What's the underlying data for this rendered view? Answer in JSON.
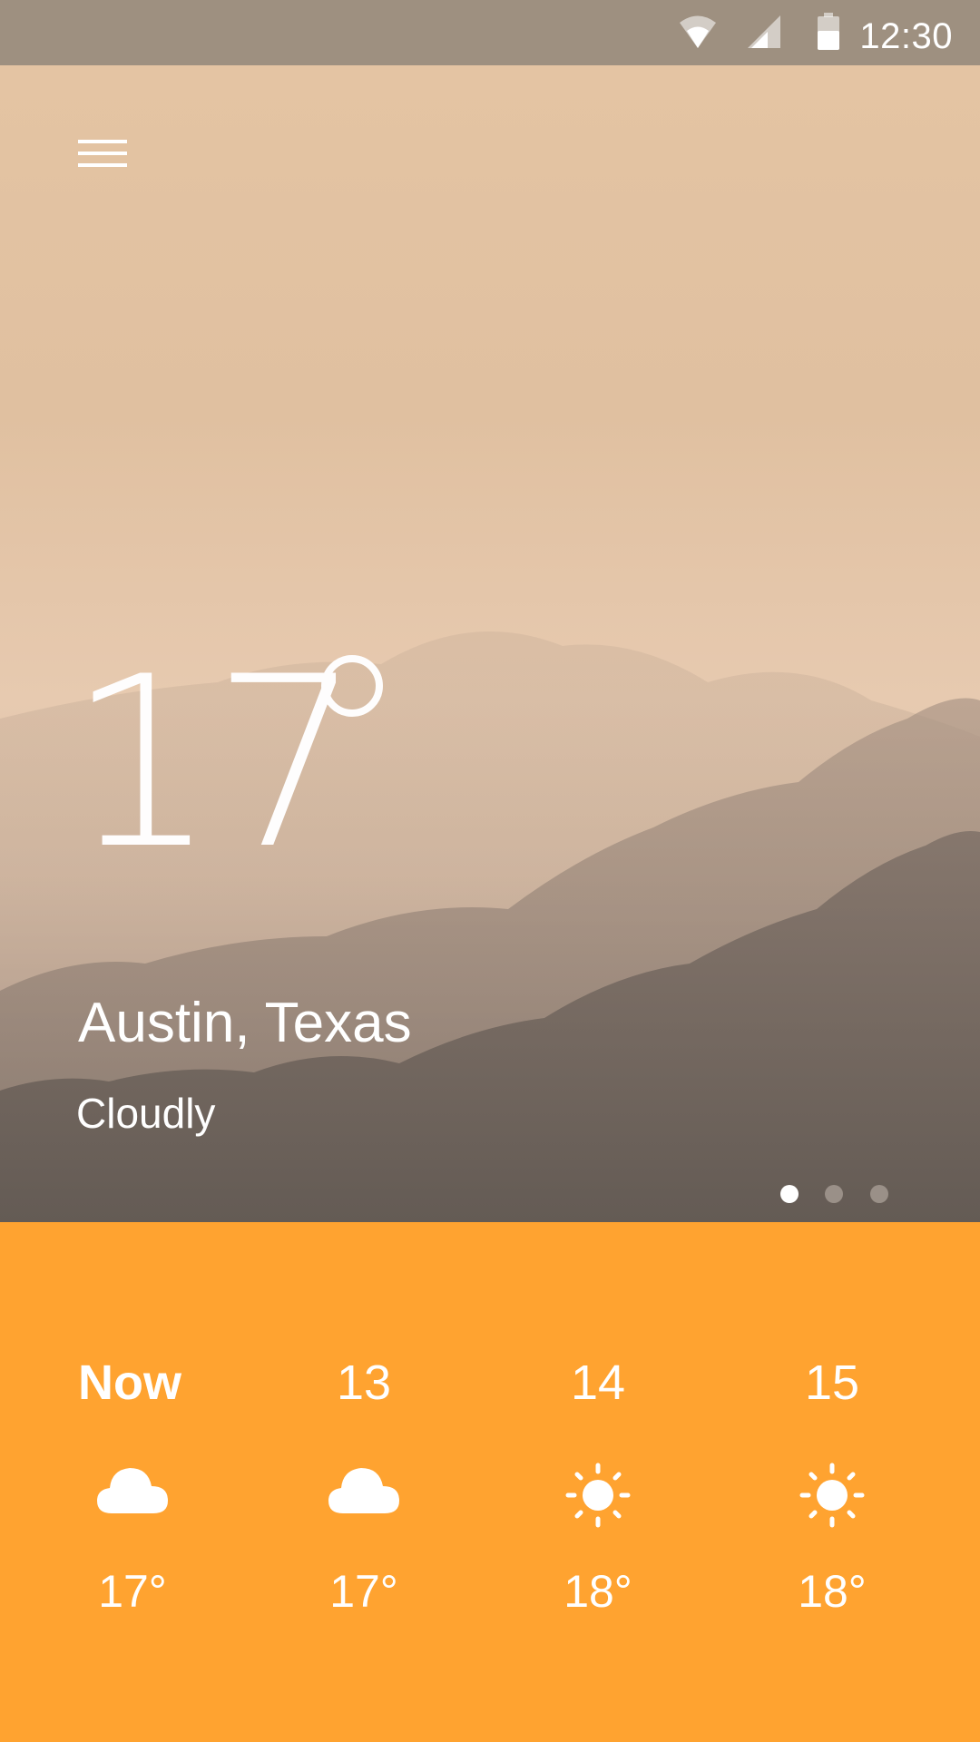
{
  "status_bar": {
    "time": "12:30",
    "icons": [
      "wifi-icon",
      "cell-signal-icon",
      "battery-icon"
    ]
  },
  "hero": {
    "menu_icon": "hamburger-menu-icon",
    "temperature": "17",
    "degree_symbol": "°",
    "city": "Austin, Texas",
    "condition": "Cloudly",
    "pager": {
      "count": 3,
      "active_index": 0
    }
  },
  "forecast": {
    "items": [
      {
        "label": "Now",
        "icon": "cloud-icon",
        "temp": "17°"
      },
      {
        "label": "13",
        "icon": "cloud-icon",
        "temp": "17°"
      },
      {
        "label": "14",
        "icon": "sun-icon",
        "temp": "18°"
      },
      {
        "label": "15",
        "icon": "sun-icon",
        "temp": "18°"
      }
    ]
  },
  "colors": {
    "status_bar": "#9e9080",
    "forecast_bg": "#ffa330",
    "text": "#ffffff"
  }
}
